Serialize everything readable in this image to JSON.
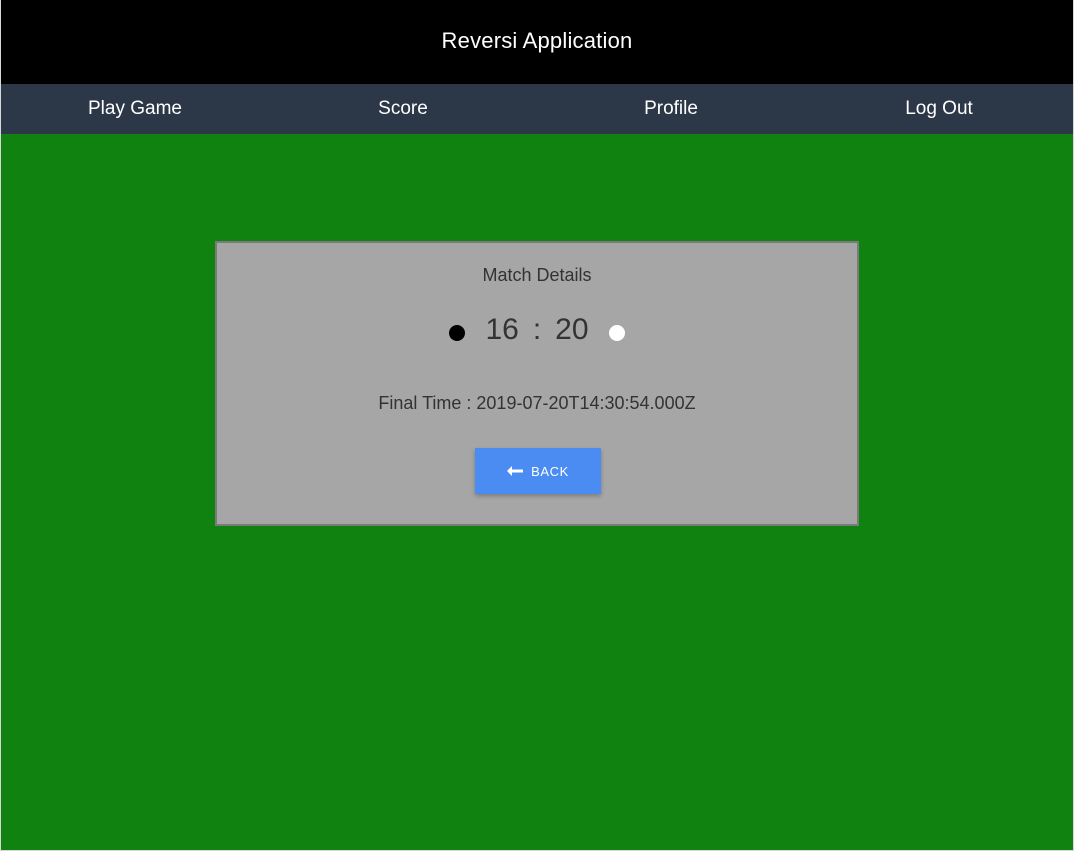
{
  "app": {
    "title": "Reversi Application"
  },
  "nav": {
    "items": [
      {
        "label": "Play Game"
      },
      {
        "label": "Score"
      },
      {
        "label": "Profile"
      },
      {
        "label": "Log Out"
      }
    ]
  },
  "match": {
    "title": "Match Details",
    "black_score": "16",
    "separator": ":",
    "white_score": "20",
    "final_time": "Final Time : 2019-07-20T14:30:54.000Z",
    "back_label": "BACK",
    "back_icon": "arrow-left-icon"
  },
  "colors": {
    "topbar": "#000000",
    "navbar": "#2c3848",
    "board_green": "#108210",
    "card": "#a6a6a6",
    "button": "#4a8cf2"
  }
}
